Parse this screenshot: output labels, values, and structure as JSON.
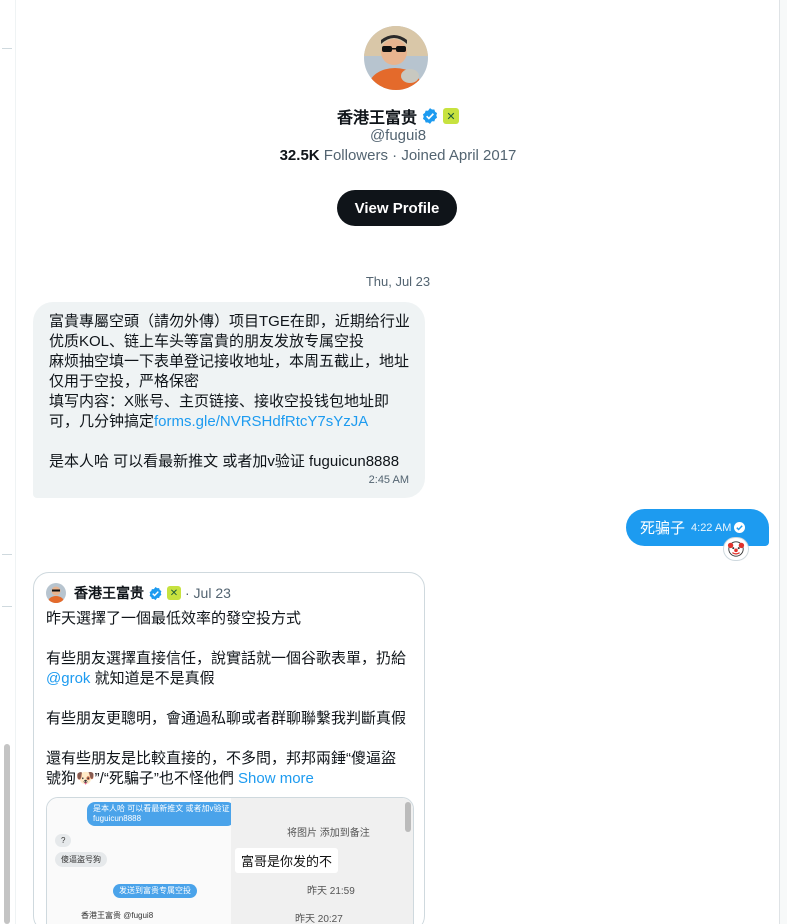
{
  "profile": {
    "name": "香港王富贵",
    "affiliate_badge": "✕",
    "handle": "@fugui8",
    "followers_count": "32.5K",
    "followers_label": "Followers",
    "joined": "· Joined April 2017",
    "view_profile_label": "View Profile"
  },
  "conversation": {
    "date_separator": "Thu, Jul 23",
    "incoming": {
      "lines": [
        "富貴專屬空頭（請勿外傳）项目TGE在即，近期给行业",
        "优质KOL、链上车头等富貴的朋友发放专属空投",
        "麻烦抽空填一下表单登记接收地址，本周五截止，地址",
        "仅用于空投，严格保密",
        "填写内容：X账号、主页链接、接收空投钱包地址即"
      ],
      "line6_text": "可，几分钟搞定",
      "link": "forms.gle/NVRSHdfRtcY7sYzJA",
      "line8": "是本人哈 可以看最新推文 或者加v验证 fuguicun8888",
      "time": "2:45 AM"
    },
    "outgoing": {
      "text": "死骗子",
      "time": "4:22 AM",
      "reaction": "🤡"
    }
  },
  "quote": {
    "name": "香港王富贵",
    "affiliate_badge": "✕",
    "date": "· Jul 23",
    "p1": "昨天選擇了一個最低效率的發空投方式",
    "p2a": "有些朋友選擇直接信任，說實話就一個谷歌表單，扔給",
    "p2b_link": "@grok",
    "p2b_text": " 就知道是不是真假",
    "p3": "有些朋友更聰明，會通過私聊或者群聊聯繫我判斷真假",
    "p4a": "還有些朋友是比較直接的，不多問，邦邦兩錘“傻逼盜",
    "p4b": "號狗🐶”/“死騙子”也不怪他們",
    "show_more": "Show more",
    "media": {
      "left_bubble1": "是本人哈 可以看最新推文 或者加v验证",
      "left_bubble1b": "fuguicun8888",
      "left_q": "?",
      "left_gray": "傻逼盗号狗",
      "left_blue2": "发送到富贵专属空投",
      "left_bottom": "香港王富贵 @fugui8",
      "right_hint": "将图片  添加到备注",
      "right_white": "富哥是你发的不",
      "right_time1": "昨天 21:59",
      "right_time2": "昨天 20:27"
    }
  },
  "colors": {
    "accent": "#1d9bf0",
    "bubble_gray": "#eff3f4",
    "text": "#0f1419",
    "muted": "#536471"
  }
}
